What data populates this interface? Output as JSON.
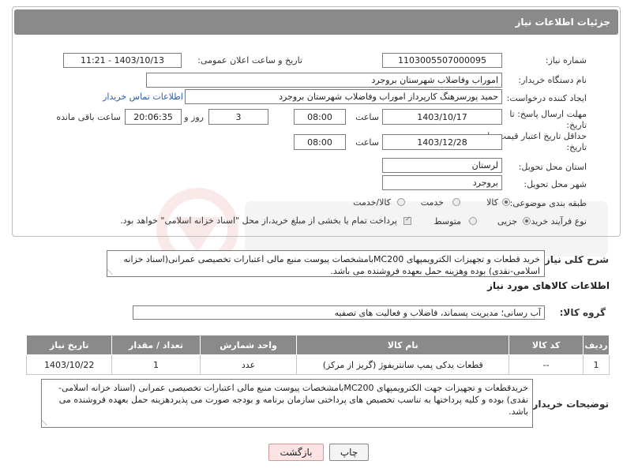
{
  "header": {
    "title": "جزئیات اطلاعات نیاز"
  },
  "form": {
    "need_number_label": "شماره نیاز:",
    "need_number": "1103005507000095",
    "announce_label": "تاریخ و ساعت اعلان عمومی:",
    "announce_value": "1403/10/13 - 11:21",
    "buyer_org_label": "نام دستگاه خریدار:",
    "buyer_org": "اموراب وفاضلاب شهرستان بروجرد",
    "requester_label": "ایجاد کننده درخواست:",
    "requester": "حمید پورسرهنگ کارپرداز اموراب وفاضلاب شهرستان بروجرد",
    "contact_link": "اطلاعات تماس خریدار",
    "deadline_label": "مهلت ارسال پاسخ: تا تاریخ:",
    "deadline_date": "1403/10/17",
    "time_label": "ساعت",
    "deadline_time": "08:00",
    "days_value": "3",
    "days_label": "روز و",
    "remaining_time": "20:06:35",
    "remaining_label": "ساعت باقی مانده",
    "price_validity_label": "حداقل تاریخ اعتبار قیمت: تا تاریخ:",
    "price_validity_date": "1403/12/28",
    "price_validity_time": "08:00",
    "province_label": "استان محل تحویل:",
    "province": "لرستان",
    "city_label": "شهر محل تحویل:",
    "city": "بروجرد",
    "category_label": "طبقه بندی موضوعی:",
    "category_options": [
      "کالا",
      "خدمت",
      "کالا/خدمت"
    ],
    "process_label": "نوع فرآیند خرید :",
    "process_options": [
      "جزیی",
      "متوسط"
    ],
    "payment_note": "پرداخت تمام یا بخشی از مبلغ خرید،از محل \"اسناد خزانه اسلامی\" خواهد بود."
  },
  "description": {
    "label": "شرح کلی نیاز:",
    "text": "خرید قطعات و تجهیزات الکترویمپهای MC200بامشخصات پیوست منبع مالی اعتبارات تخصیصی عمرانی(اسناد خزانه اسلامی-نقدی) بوده وهزینه حمل بعهده فروشنده می باشد."
  },
  "goods_section": {
    "title": "اطلاعات کالاهای مورد نیاز",
    "group_label": "گروه کالا:",
    "group_value": "آب رسانی؛ مدیریت پسماند، فاضلاب و فعالیت های تصفیه"
  },
  "table": {
    "headers": [
      "ردیف",
      "کد کالا",
      "نام کالا",
      "واحد شمارش",
      "تعداد / مقدار",
      "تاریخ نیاز"
    ],
    "rows": [
      {
        "row": "1",
        "code": "--",
        "name": "قطعات یدکی پمپ سانتریفوژ (گریز از مرکز)",
        "unit": "عدد",
        "qty": "1",
        "date": "1403/10/22"
      }
    ]
  },
  "buyer_notes": {
    "label": "توضیحات خریدار:",
    "text": "خریدقطعات و تجهیزات جهت الکترویمپهای MC200بامشخصات پیوست منبع مالی اعتبارات تخصیصی عمرانی (اسناد خزانه اسلامی-نقدی) بوده و کلیه پرداختها به تناسب تخصیص های پرداختی سازمان برنامه و بودجه صورت می پذیردهزینه حمل بعهده فروشنده می باشد."
  },
  "buttons": {
    "print": "چاپ",
    "back": "بازگشت"
  },
  "colors": {
    "header_bg": "#8a8a8a",
    "link": "#2a5db0",
    "back_button_bg": "#fde3e3"
  }
}
